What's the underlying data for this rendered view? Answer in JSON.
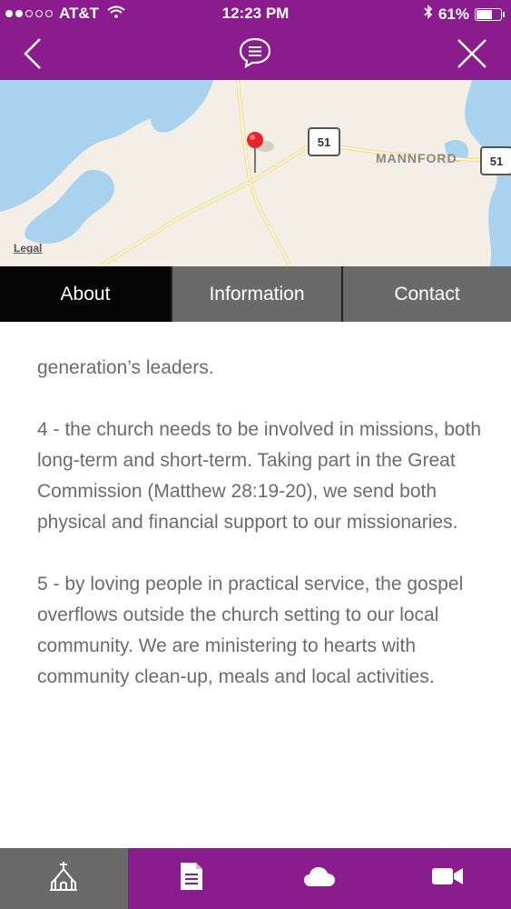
{
  "status_bar": {
    "carrier": "AT&T",
    "time": "12:23 PM",
    "battery": "61%"
  },
  "nav": {
    "back_icon": "chevron-left-icon",
    "center_icon": "chat-bubble-icon",
    "close_icon": "close-icon"
  },
  "map": {
    "legal_label": "Legal",
    "place_label": "MANNFORD",
    "route_shield_1": "51",
    "route_shield_2": "51"
  },
  "tabs": [
    {
      "label": "About",
      "active": true
    },
    {
      "label": "Information",
      "active": false
    },
    {
      "label": "Contact",
      "active": false
    }
  ],
  "content": {
    "paragraphs": [
      "generation’s leaders.",
      "4 - the church needs to be involved in missions, both long-term and short-term. Taking part in the Great Commission (Matthew 28:19-20), we send both physical and financial support to our missionaries.",
      "5 - by loving people in practical service, the gospel overflows outside the church setting to our local community.  We are ministering to hearts with community clean-up, meals and local activities."
    ]
  },
  "bottom_nav": [
    {
      "icon": "church-icon",
      "active": true
    },
    {
      "icon": "document-icon",
      "active": false
    },
    {
      "icon": "cloud-icon",
      "active": false
    },
    {
      "icon": "video-camera-icon",
      "active": false
    }
  ],
  "colors": {
    "brand": "#8b1c8e",
    "tab_active": "#050505",
    "tab_inactive": "#6a6a6a",
    "map_water": "#a9d2ef",
    "map_land": "#f3efe6",
    "pin": "#e8242b"
  }
}
